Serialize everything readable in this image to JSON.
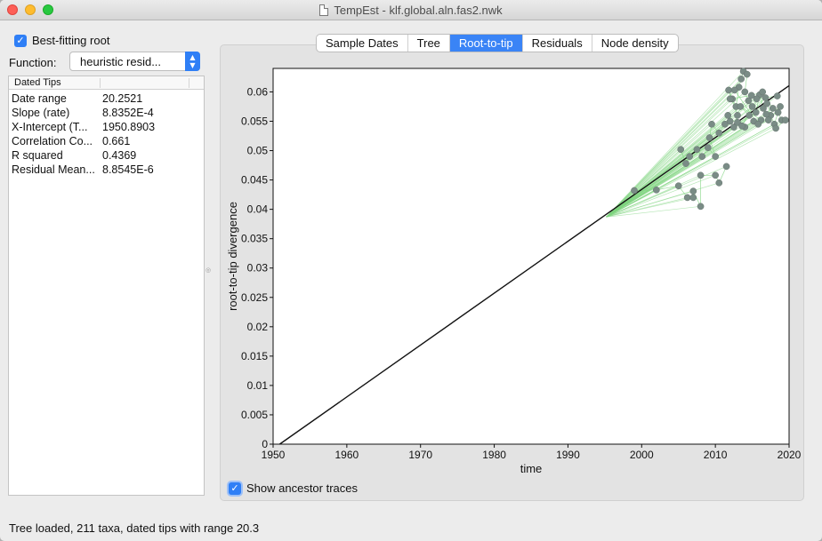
{
  "window": {
    "title": "TempEst - klf.global.aln.fas2.nwk"
  },
  "controls": {
    "best_fitting_root": {
      "label": "Best-fitting root",
      "checked": true
    },
    "function": {
      "label": "Function:",
      "value": "heuristic resid..."
    }
  },
  "table": {
    "header": "Dated Tips",
    "rows": [
      {
        "key": "Date range",
        "value": "20.2521"
      },
      {
        "key": "Slope (rate)",
        "value": "8.8352E-4"
      },
      {
        "key": "X-Intercept (T...",
        "value": "1950.8903"
      },
      {
        "key": "Correlation Co...",
        "value": "0.661"
      },
      {
        "key": "R squared",
        "value": "0.4369"
      },
      {
        "key": "Residual Mean...",
        "value": "8.8545E-6"
      }
    ]
  },
  "tabs": [
    {
      "label": "Sample Dates",
      "active": false
    },
    {
      "label": "Tree",
      "active": false
    },
    {
      "label": "Root-to-tip",
      "active": true
    },
    {
      "label": "Residuals",
      "active": false
    },
    {
      "label": "Node density",
      "active": false
    }
  ],
  "ancestor_traces": {
    "label": "Show ancestor traces",
    "checked": true
  },
  "status": "Tree loaded, 211 taxa, dated tips with range 20.3",
  "colors": {
    "accent": "#3a84f6",
    "point": "#7a8c86",
    "trace": "#7fd47f",
    "line": "#111111"
  },
  "chart_data": {
    "type": "scatter",
    "xlabel": "time",
    "ylabel": "root-to-tip divergence",
    "xlim": [
      1950,
      2020
    ],
    "ylim": [
      0,
      0.064
    ],
    "xticks": [
      "1950",
      "1960",
      "1970",
      "1980",
      "1990",
      "2000",
      "2010",
      "2020"
    ],
    "yticks": [
      "0",
      "0.005",
      "0.01",
      "0.015",
      "0.02",
      "0.025",
      "0.03",
      "0.035",
      "0.04",
      "0.045",
      "0.05",
      "0.055",
      "0.06"
    ],
    "regression": {
      "slope": 0.00088352,
      "x_intercept": 1950.8903
    },
    "ancestor": {
      "x": 1995.2,
      "y": 0.0387
    },
    "points": [
      [
        1999.0,
        0.0432
      ],
      [
        2002.0,
        0.0433
      ],
      [
        2005.0,
        0.044
      ],
      [
        2006.2,
        0.042
      ],
      [
        2007.0,
        0.042
      ],
      [
        2007.0,
        0.0431
      ],
      [
        2008.0,
        0.0405
      ],
      [
        2008.0,
        0.0458
      ],
      [
        2010.0,
        0.0458
      ],
      [
        2010.5,
        0.0445
      ],
      [
        2011.5,
        0.0473
      ],
      [
        2005.3,
        0.0502
      ],
      [
        2006.0,
        0.0478
      ],
      [
        2006.5,
        0.049
      ],
      [
        2007.5,
        0.0502
      ],
      [
        2008.2,
        0.049
      ],
      [
        2009.0,
        0.0505
      ],
      [
        2010.0,
        0.049
      ],
      [
        2009.2,
        0.0522
      ],
      [
        2009.5,
        0.0545
      ],
      [
        2010.5,
        0.053
      ],
      [
        2011.3,
        0.0545
      ],
      [
        2012.0,
        0.055
      ],
      [
        2012.5,
        0.054
      ],
      [
        2013.0,
        0.056
      ],
      [
        2011.8,
        0.0603
      ],
      [
        2012.3,
        0.0588
      ],
      [
        2012.8,
        0.0575
      ],
      [
        2013.2,
        0.0608
      ],
      [
        2013.5,
        0.0622
      ],
      [
        2013.8,
        0.0635
      ],
      [
        2014.3,
        0.063
      ],
      [
        2014.0,
        0.06
      ],
      [
        2014.5,
        0.0585
      ],
      [
        2015.0,
        0.0575
      ],
      [
        2015.5,
        0.0565
      ],
      [
        2016.0,
        0.0595
      ],
      [
        2016.5,
        0.0572
      ],
      [
        2017.0,
        0.058
      ],
      [
        2017.5,
        0.056
      ],
      [
        2018.0,
        0.0545
      ],
      [
        2018.5,
        0.0565
      ],
      [
        2019.0,
        0.0552
      ],
      [
        2019.5,
        0.0552
      ],
      [
        2018.2,
        0.0538
      ],
      [
        2013.0,
        0.0548
      ],
      [
        2014.0,
        0.054
      ],
      [
        2015.2,
        0.055
      ],
      [
        2016.2,
        0.0552
      ],
      [
        2013.4,
        0.0575
      ],
      [
        2014.6,
        0.056
      ],
      [
        2016.8,
        0.059
      ],
      [
        2017.8,
        0.0572
      ],
      [
        2012.6,
        0.0603
      ],
      [
        2015.8,
        0.0545
      ],
      [
        2017.2,
        0.0552
      ],
      [
        2018.8,
        0.0575
      ],
      [
        2012.0,
        0.0588
      ],
      [
        2014.9,
        0.0594
      ],
      [
        2016.4,
        0.06
      ],
      [
        2013.6,
        0.0542
      ],
      [
        2015.6,
        0.0588
      ],
      [
        2018.4,
        0.0593
      ],
      [
        2011.7,
        0.056
      ],
      [
        2016.9,
        0.0562
      ]
    ]
  }
}
